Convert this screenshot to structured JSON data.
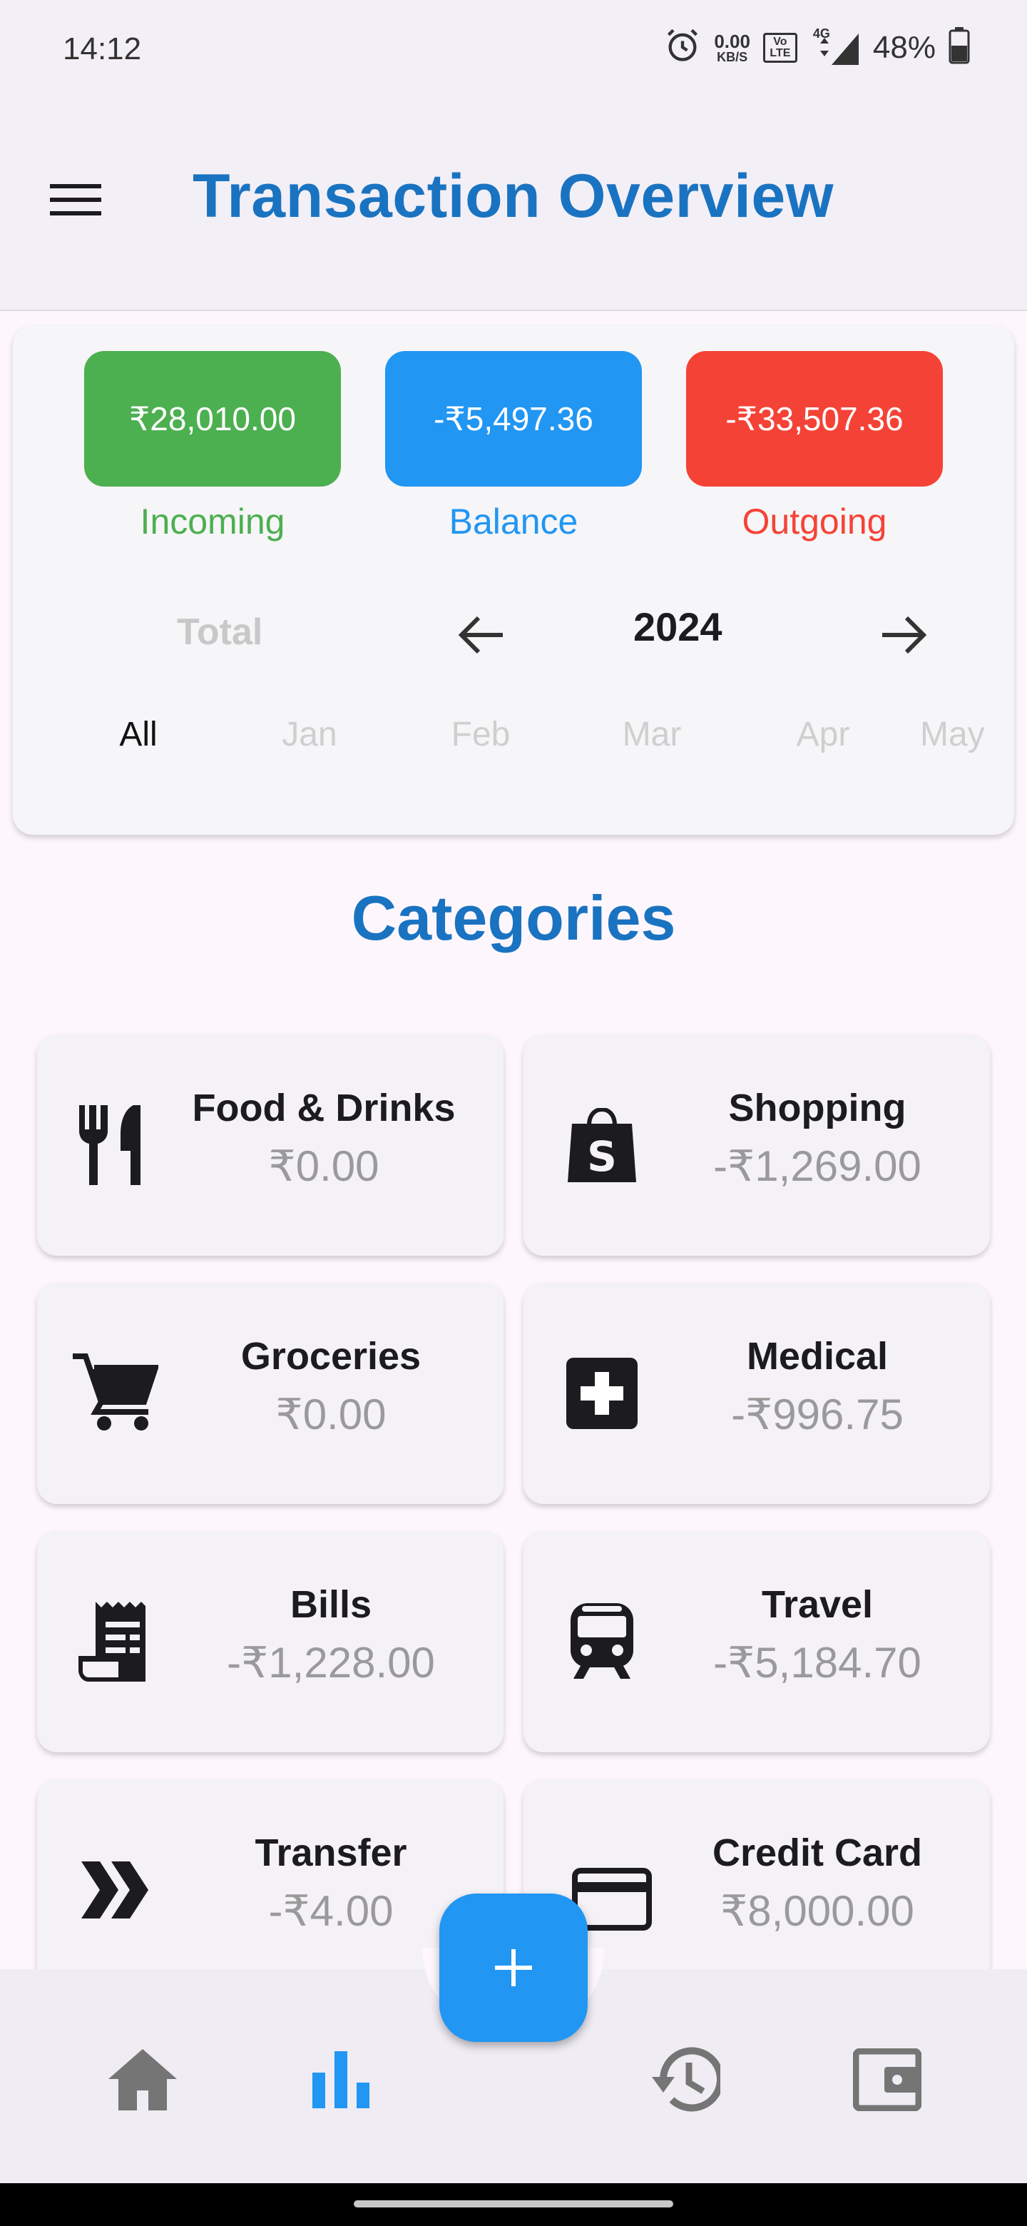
{
  "status_bar": {
    "time": "14:12",
    "net_speed": "0.00",
    "net_unit": "KB/S",
    "volte": "Vo LTE",
    "network": "4G",
    "battery": "48%"
  },
  "app_bar": {
    "title": "Transaction Overview",
    "menu_icon": "menu-icon"
  },
  "overview": {
    "incoming": {
      "amount": "₹28,010.00",
      "label": "Incoming",
      "color": "#4caf50"
    },
    "balance": {
      "amount": "-₹5,497.36",
      "label": "Balance",
      "color": "#2196f3"
    },
    "outgoing": {
      "amount": "-₹33,507.36",
      "label": "Outgoing",
      "color": "#f44336"
    },
    "total_label": "Total",
    "year": "2024",
    "months": [
      "All",
      "Jan",
      "Feb",
      "Mar",
      "Apr",
      "May"
    ],
    "selected_month": "All"
  },
  "categories_title": "Categories",
  "categories": [
    {
      "name": "Food & Drinks",
      "value": "₹0.00",
      "icon": "fork-knife-icon"
    },
    {
      "name": "Shopping",
      "value": "-₹1,269.00",
      "icon": "shopping-bag-icon"
    },
    {
      "name": "Groceries",
      "value": "₹0.00",
      "icon": "cart-icon"
    },
    {
      "name": "Medical",
      "value": "-₹996.75",
      "icon": "medical-cross-icon"
    },
    {
      "name": "Bills",
      "value": "-₹1,228.00",
      "icon": "receipt-icon"
    },
    {
      "name": "Travel",
      "value": "-₹5,184.70",
      "icon": "train-icon"
    },
    {
      "name": "Transfer",
      "value": "-₹4.00",
      "icon": "double-chevron-icon"
    },
    {
      "name": "Credit Card",
      "value": "₹8,000.00",
      "icon": "credit-card-icon"
    }
  ],
  "bottom_nav": {
    "items": [
      "home-icon",
      "bar-chart-icon",
      "history-icon",
      "wallet-icon"
    ],
    "active": "bar-chart-icon",
    "active_color": "#2196f3",
    "inactive_color": "#757575"
  },
  "fab": {
    "label": "+",
    "color": "#2196f3"
  }
}
